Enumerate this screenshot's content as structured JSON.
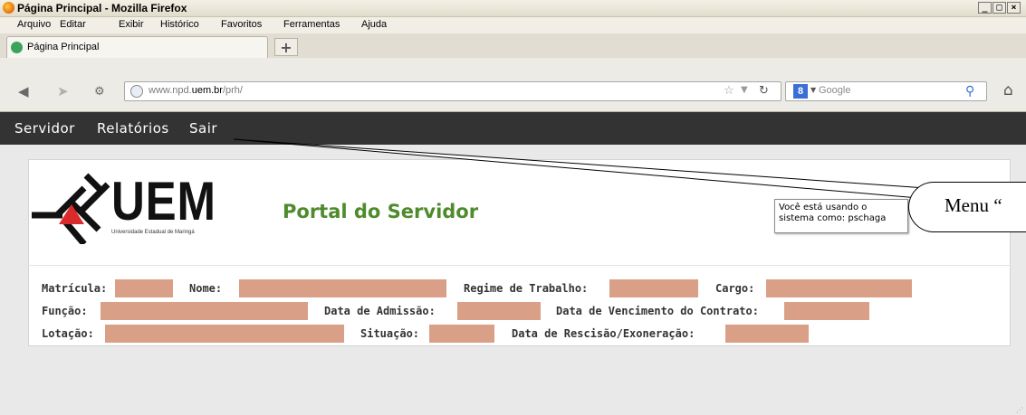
{
  "window": {
    "title": "Página Principal - Mozilla Firefox",
    "controls": [
      "_",
      "□",
      "×"
    ]
  },
  "menu": {
    "items": [
      "Arquivo",
      "Editar",
      "Exibir",
      "Histórico",
      "Favoritos",
      "Ferramentas",
      "Ajuda"
    ]
  },
  "tab": {
    "label": "Página Principal",
    "new_tab_symbol": "+"
  },
  "nav": {
    "url_prefix": "www.npd.",
    "url_domain": "uem.br",
    "url_path": "/prh/",
    "search_engine": "Google",
    "search_engine_icon": "8"
  },
  "site_menu": {
    "items": [
      "Servidor",
      "Relatórios",
      "Sair"
    ]
  },
  "header": {
    "logo_text": "UEM",
    "logo_subtitle": "Universidade Estadual de Maringá",
    "portal_title": "Portal do Servidor",
    "user_line1": "Você está usando o",
    "user_line2": "sistema como: pschaga"
  },
  "annotation": {
    "callout_text": "Menu “"
  },
  "fields": {
    "matricula": "Matrícula:",
    "nome": "Nome:",
    "regime": "Regime de Trabalho:",
    "cargo": "Cargo:",
    "funcao": "Função:",
    "admissao": "Data de Admissão:",
    "vencimento": "Data de Vencimento do Contrato:",
    "lotacao": "Lotação:",
    "situacao": "Situação:",
    "rescisao": "Data de Rescisão/Exoneração:"
  },
  "colors": {
    "site_menu_bg": "#333333",
    "field_fill": "#d99f87",
    "portal_title": "#4e8b2c"
  }
}
